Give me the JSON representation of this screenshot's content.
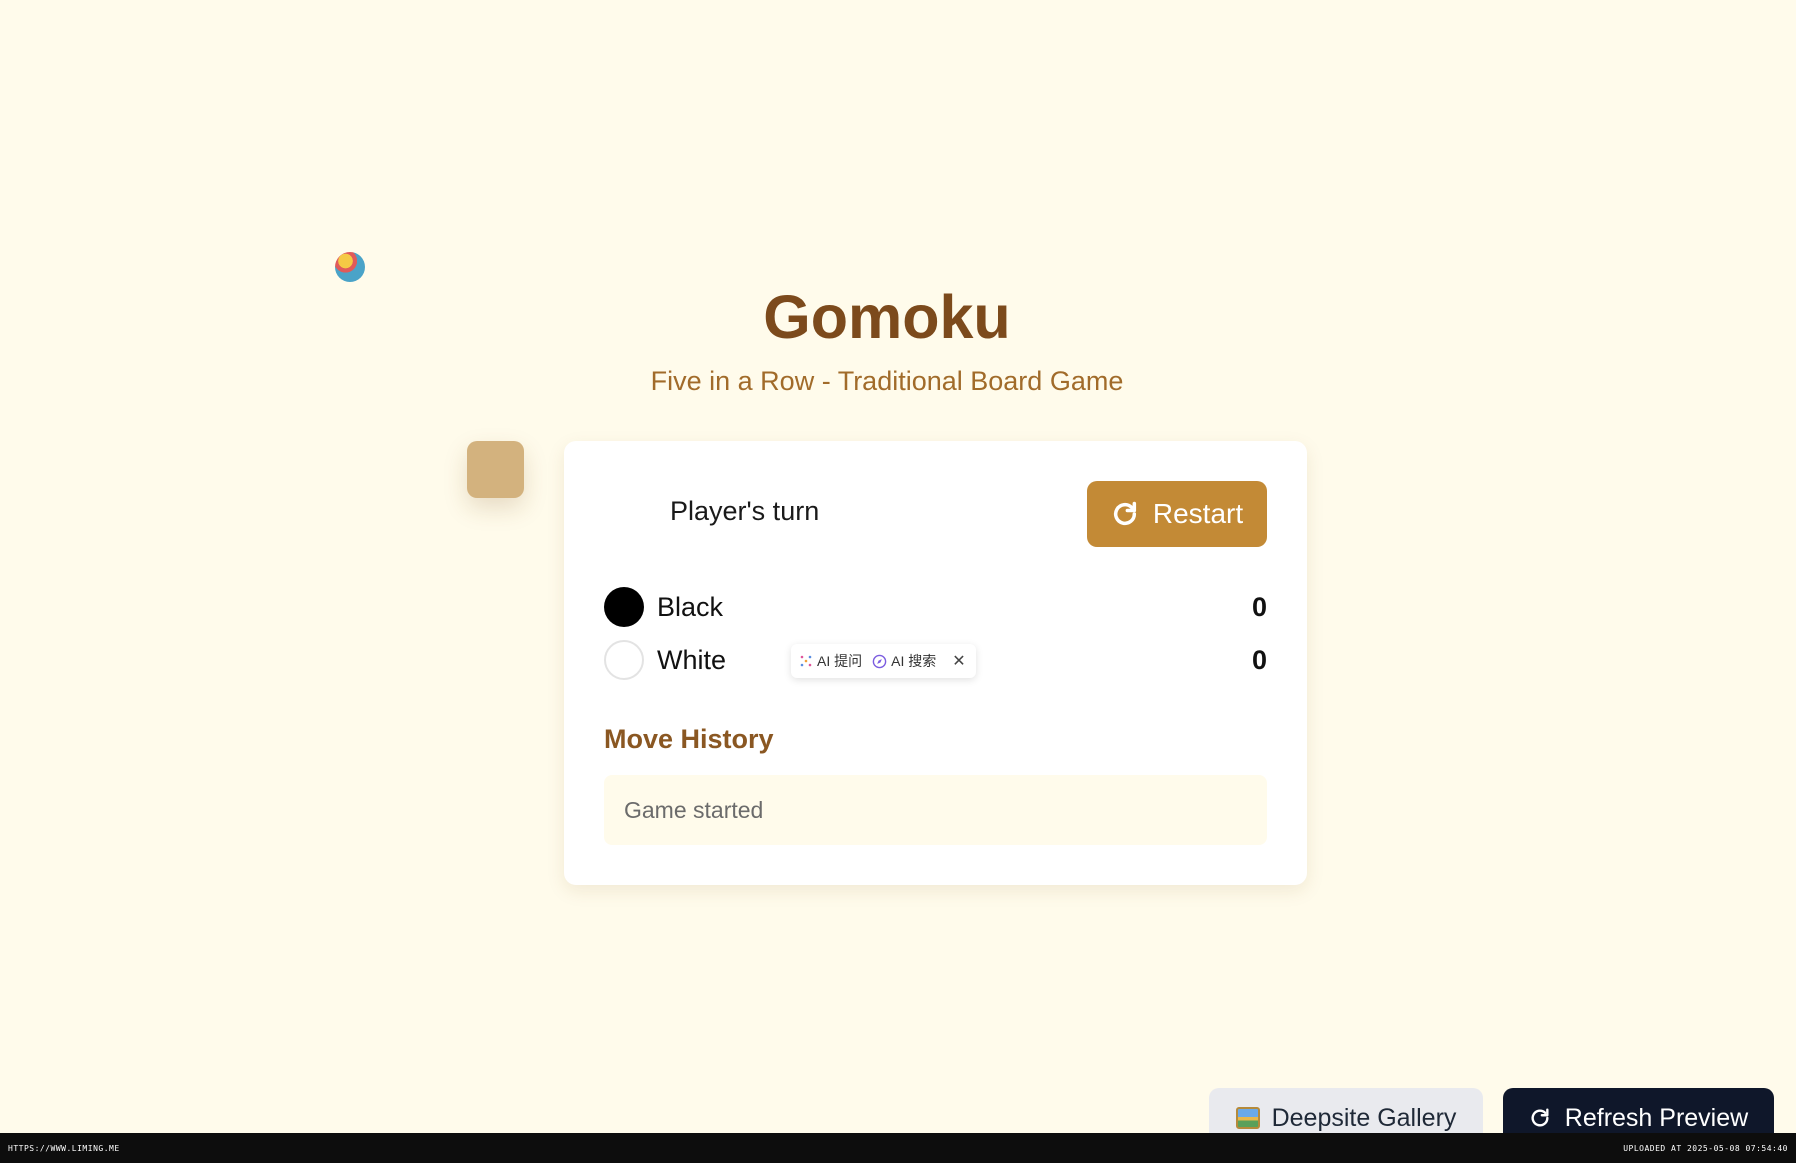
{
  "header": {
    "title": "Gomoku",
    "subtitle": "Five in a Row - Traditional Board Game"
  },
  "status": {
    "turn_text": "Player's turn"
  },
  "controls": {
    "restart_label": "Restart"
  },
  "players": [
    {
      "name": "Black",
      "score": "0",
      "stone_color": "#000000"
    },
    {
      "name": "White",
      "score": "0",
      "stone_color": "#ffffff"
    }
  ],
  "ai_popup": {
    "ask_label": "AI 提问",
    "search_label": "AI 搜索",
    "close_glyph": "✕"
  },
  "history": {
    "heading": "Move History",
    "entries": [
      "Game started"
    ]
  },
  "footer_buttons": {
    "gallery_label": "Deepsite Gallery",
    "refresh_label": "Refresh Preview"
  },
  "watermark": {
    "url": "HTTPS://WWW.LIMING.ME",
    "uploaded": "UPLOADED AT 2025-05-08 07:54:40"
  },
  "colors": {
    "background": "#fffbeb",
    "title": "#7c4a1c",
    "accent": "#c38a36",
    "dark_button": "#0f172a"
  }
}
